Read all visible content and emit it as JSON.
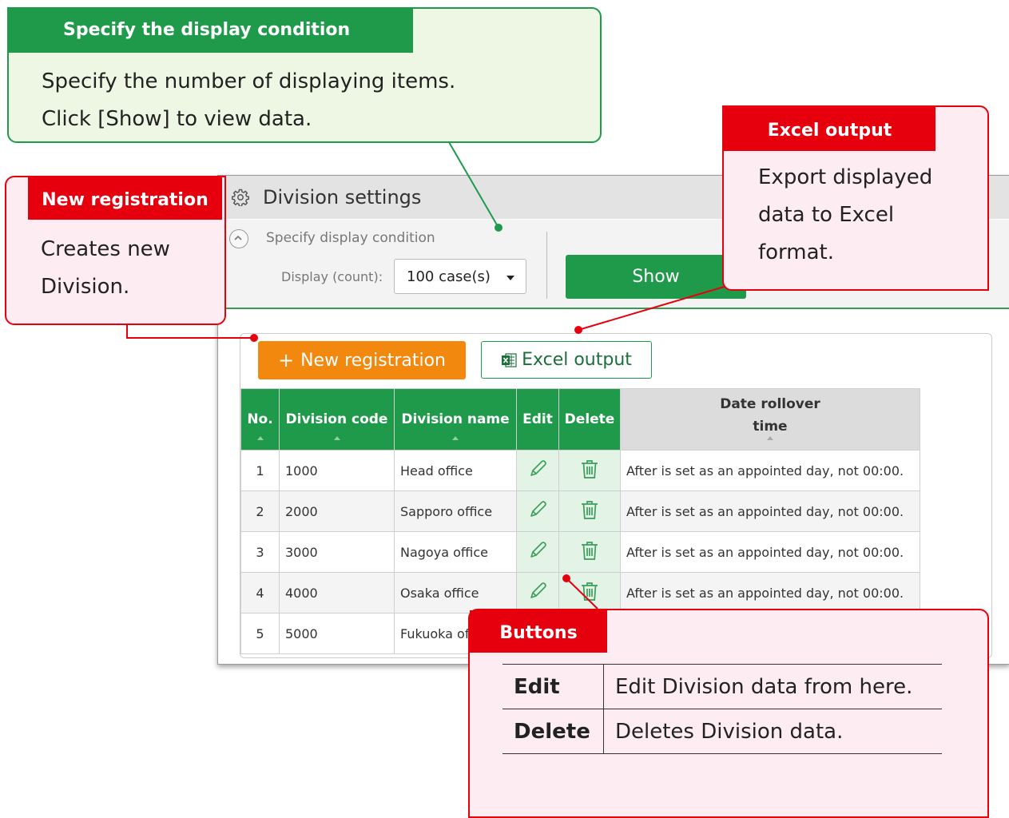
{
  "app": {
    "title": "Division settings",
    "condition_title": "Specify display condition",
    "display_label": "Display (count):",
    "display_value": "100 case(s)",
    "show_label": "Show",
    "new_registration_label": "New registration",
    "new_registration_plus": "+",
    "excel_output_label": "Excel output"
  },
  "table": {
    "headers": {
      "no": "No.",
      "code": "Division code",
      "name": "Division name",
      "edit": "Edit",
      "delete": "Delete",
      "rollover_line1": "Date rollover",
      "rollover_line2": "time"
    },
    "rows": [
      {
        "no": "1",
        "code": "1000",
        "name": "Head office",
        "rollover": "After is set as an appointed day, not 00:00."
      },
      {
        "no": "2",
        "code": "2000",
        "name": "Sapporo office",
        "rollover": "After is set as an appointed day, not 00:00."
      },
      {
        "no": "3",
        "code": "3000",
        "name": "Nagoya office",
        "rollover": "After is set as an appointed day, not 00:00."
      },
      {
        "no": "4",
        "code": "4000",
        "name": "Osaka office",
        "rollover": "After is set as an appointed day, not 00:00."
      },
      {
        "no": "5",
        "code": "5000",
        "name": "Fukuoka of",
        "rollover": ""
      }
    ]
  },
  "callouts": {
    "display": {
      "tag": "Specify the display condition",
      "line1": "Specify the number of displaying items.",
      "line2": "Click [Show] to view data."
    },
    "new": {
      "tag": "New registration",
      "line1": "Creates new",
      "line2": "Division."
    },
    "excel": {
      "tag": "Excel output",
      "line1": "Export displayed",
      "line2": "data to Excel",
      "line3": "format."
    },
    "buttons": {
      "tag": "Buttons",
      "edit_key": "Edit",
      "edit_desc": "Edit Division data from here.",
      "delete_key": "Delete",
      "delete_desc": "Deletes Division data."
    }
  },
  "colors": {
    "green": "#1f9a4b",
    "orange": "#f3880e",
    "red": "#e6000e",
    "callout_green_bg": "#eef7e4",
    "callout_red_bg": "#fdecf2"
  },
  "icons": [
    "gear-icon",
    "chevron-up-icon",
    "dropdown-arrow-icon",
    "excel-icon",
    "pencil-icon",
    "trash-icon"
  ]
}
